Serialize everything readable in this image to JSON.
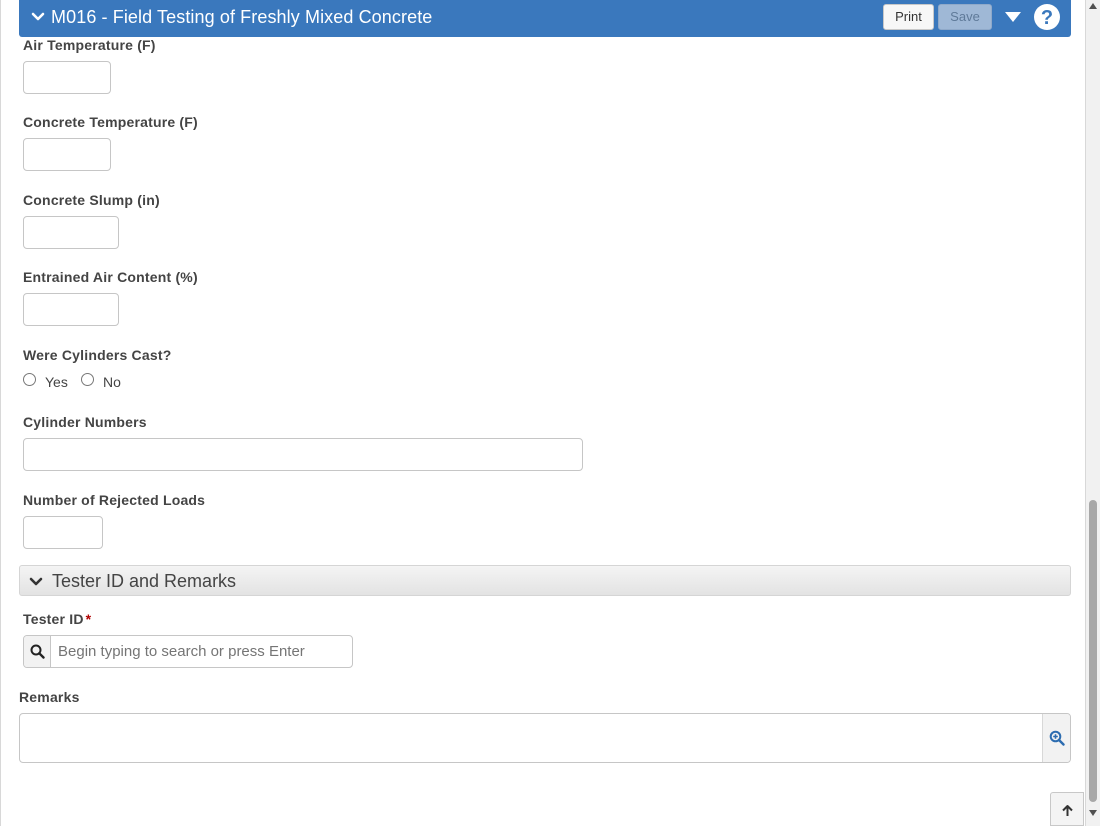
{
  "header": {
    "title": "M016 - Field Testing of Freshly Mixed Concrete",
    "print_label": "Print",
    "save_label": "Save",
    "color": "#3a78bd"
  },
  "fields": {
    "air_temp_label": "Air Temperature (F)",
    "air_temp_value": "",
    "concrete_temp_label": "Concrete Temperature (F)",
    "concrete_temp_value": "",
    "slump_label": "Concrete Slump (in)",
    "slump_value": "",
    "air_content_label": "Entrained Air Content (%)",
    "air_content_value": "",
    "cylinders_cast_label": "Were Cylinders Cast?",
    "cylinders_cast_options": [
      "Yes",
      "No"
    ],
    "cylinder_numbers_label": "Cylinder Numbers",
    "cylinder_numbers_value": "",
    "rejected_loads_label": "Number of Rejected Loads",
    "rejected_loads_value": ""
  },
  "section_tester": {
    "title": "Tester ID and Remarks",
    "tester_id_label": "Tester ID",
    "required_marker": "*",
    "tester_search_placeholder": "Begin typing to search or press Enter",
    "remarks_label": "Remarks",
    "remarks_value": ""
  },
  "icons": {
    "header_chevron": "chevron-down-icon",
    "menu": "caret-down-icon",
    "help": "help-icon",
    "search": "search-icon",
    "zoom": "zoom-in-icon",
    "back_to_top": "arrow-up-icon"
  }
}
